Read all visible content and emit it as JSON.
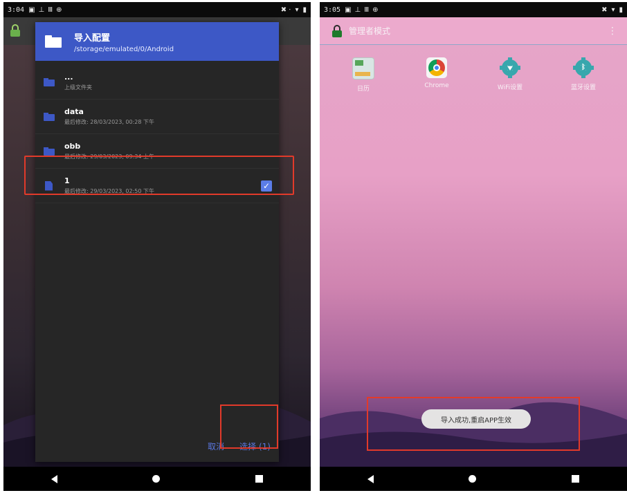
{
  "left": {
    "status": {
      "time": "3:04",
      "icons": [
        "▣",
        "⊥",
        "Ⅲ",
        "⊕"
      ],
      "right_icons": [
        "✖ ⋅",
        "▾",
        "▮"
      ]
    },
    "dialog": {
      "title": "导入配置",
      "path": "/storage/emulated/0/Android",
      "items": [
        {
          "name": "...",
          "meta": "上级文件夹",
          "type": "folder",
          "checked": false
        },
        {
          "name": "data",
          "meta": "最后修改: 28/03/2023, 00:28 下午",
          "type": "folder",
          "checked": false
        },
        {
          "name": "obb",
          "meta": "最后修改: 29/03/2023, 09:34 上午",
          "type": "folder",
          "checked": false
        },
        {
          "name": "1",
          "meta": "最后修改: 29/03/2023, 02:50 下午",
          "type": "file",
          "checked": true
        }
      ],
      "cancel_label": "取消",
      "select_label": "选择 (1)"
    }
  },
  "right": {
    "status": {
      "time": "3:05",
      "icons": [
        "▣",
        "⊥",
        "Ⅲ",
        "⊕"
      ],
      "right_icons": [
        "✖",
        "▾",
        "▮"
      ]
    },
    "app_title": "管理者模式",
    "menu_icon": "⋮",
    "apps": [
      {
        "label": "日历",
        "icon": "calendar-icon"
      },
      {
        "label": "Chrome",
        "icon": "chrome-icon"
      },
      {
        "label": "WiFi设置",
        "icon": "wifi-settings-icon"
      },
      {
        "label": "蓝牙设置",
        "icon": "bluetooth-settings-icon"
      }
    ],
    "toast": "导入成功,重启APP生效"
  },
  "colors": {
    "accent": "#3d58c6",
    "highlight": "#e23a2a",
    "checkbox": "#5b7de8"
  }
}
